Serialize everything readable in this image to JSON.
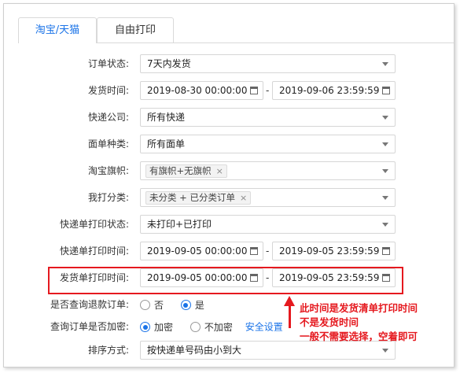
{
  "tabs": [
    {
      "label": "淘宝/天猫",
      "active": true
    },
    {
      "label": "自由打印",
      "active": false
    }
  ],
  "form": {
    "order_status": {
      "label": "订单状态:",
      "value": "7天内发货"
    },
    "ship_time": {
      "label": "发货时间:",
      "start": "2019-08-30 00:00:00",
      "end": "2019-09-06 23:59:59",
      "separator": "-"
    },
    "courier": {
      "label": "快递公司:",
      "value": "所有快递"
    },
    "waybill_type": {
      "label": "面单种类:",
      "value": "所有面单"
    },
    "taobao_flag": {
      "label": "淘宝旗帜:",
      "tag": "有旗帜+无旗帜",
      "tag_remove": "×"
    },
    "my_category": {
      "label": "我打分类:",
      "tag": "未分类 + 已分类订单",
      "tag_remove": "×"
    },
    "waybill_print_status": {
      "label": "快递单打印状态:",
      "value": "未打印+已打印"
    },
    "waybill_print_time": {
      "label": "快递单打印时间:",
      "start": "2019-09-05 00:00:00",
      "end": "2019-09-05 23:59:59",
      "separator": "-"
    },
    "ship_list_print_time": {
      "label": "发货单打印时间:",
      "start": "2019-09-05 00:00:00",
      "end": "2019-09-05 23:59:59",
      "separator": "-"
    },
    "query_refund": {
      "label": "是否查询退款订单:",
      "options": [
        "否",
        "是"
      ],
      "selected": "是"
    },
    "query_encrypted": {
      "label": "查询订单是否加密:",
      "options": [
        "加密",
        "不加密"
      ],
      "selected": "加密",
      "link": "安全设置"
    },
    "sort": {
      "label": "排序方式:",
      "value": "按快递单号码由小到大"
    }
  },
  "annotation": {
    "lines": [
      "此时间是发货清单打印时间",
      "不是发货时间",
      "一般不需要选择，空着即可"
    ],
    "color": "#e5191f"
  },
  "colors": {
    "accent": "#1a73e8",
    "annotation_red": "#e5191f"
  },
  "icons": [
    "calendar-icon",
    "chevron-down-icon",
    "close-icon",
    "arrow-up-icon"
  ]
}
